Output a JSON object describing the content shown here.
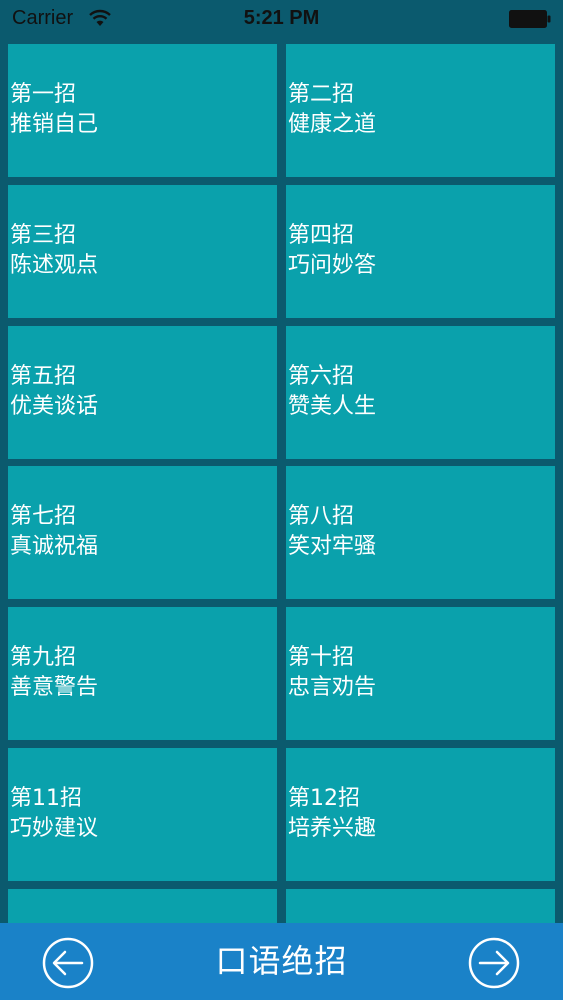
{
  "status_bar": {
    "carrier": "Carrier",
    "time": "5:21 PM",
    "wifi_icon": "wifi-icon",
    "battery_icon": "battery-icon"
  },
  "tiles": [
    {
      "line1": "第一招",
      "line2": "推销自己"
    },
    {
      "line1": "第二招",
      "line2": "健康之道"
    },
    {
      "line1": "第三招",
      "line2": "陈述观点"
    },
    {
      "line1": "第四招",
      "line2": "巧问妙答"
    },
    {
      "line1": "第五招",
      "line2": "优美谈话"
    },
    {
      "line1": "第六招",
      "line2": "赞美人生"
    },
    {
      "line1": "第七招",
      "line2": "真诚祝福"
    },
    {
      "line1": "第八招",
      "line2": "笑对牢骚"
    },
    {
      "line1": "第九招",
      "line2": "善意警告"
    },
    {
      "line1": "第十招",
      "line2": "忠言劝告"
    },
    {
      "line1": "第11招",
      "line2": "巧妙建议"
    },
    {
      "line1": "第12招",
      "line2": "培养兴趣"
    },
    {
      "line1": "",
      "line2": ""
    },
    {
      "line1": "",
      "line2": ""
    }
  ],
  "bottom_bar": {
    "title": "口语绝招",
    "prev_icon": "arrow-left-circle-icon",
    "next_icon": "arrow-right-circle-icon"
  },
  "colors": {
    "background": "#0b5a6e",
    "tile": "#0aa1ac",
    "bottom_bar": "#1a82c8",
    "text": "#ffffff"
  }
}
